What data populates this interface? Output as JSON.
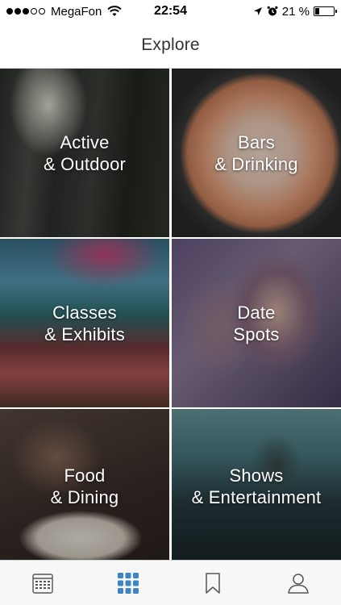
{
  "status_bar": {
    "carrier": "MegaFon",
    "time": "22:54",
    "battery": "21 %",
    "battery_level": 0.21,
    "signal_bars_filled": 3,
    "signal_bars_total": 5
  },
  "nav": {
    "title": "Explore"
  },
  "categories": [
    {
      "label": "Active\n& Outdoor"
    },
    {
      "label": "Bars\n& Drinking"
    },
    {
      "label": "Classes\n& Exhibits"
    },
    {
      "label": "Date\nSpots"
    },
    {
      "label": "Food\n& Dining"
    },
    {
      "label": "Shows\n& Entertainment"
    }
  ],
  "tab_bar": {
    "active_color": "#3d86c6",
    "inactive_color": "#555555",
    "tabs": [
      {
        "icon": "calendar-icon",
        "active": false
      },
      {
        "icon": "grid-icon",
        "active": true
      },
      {
        "icon": "bookmark-icon",
        "active": false
      },
      {
        "icon": "profile-icon",
        "active": false
      }
    ]
  }
}
